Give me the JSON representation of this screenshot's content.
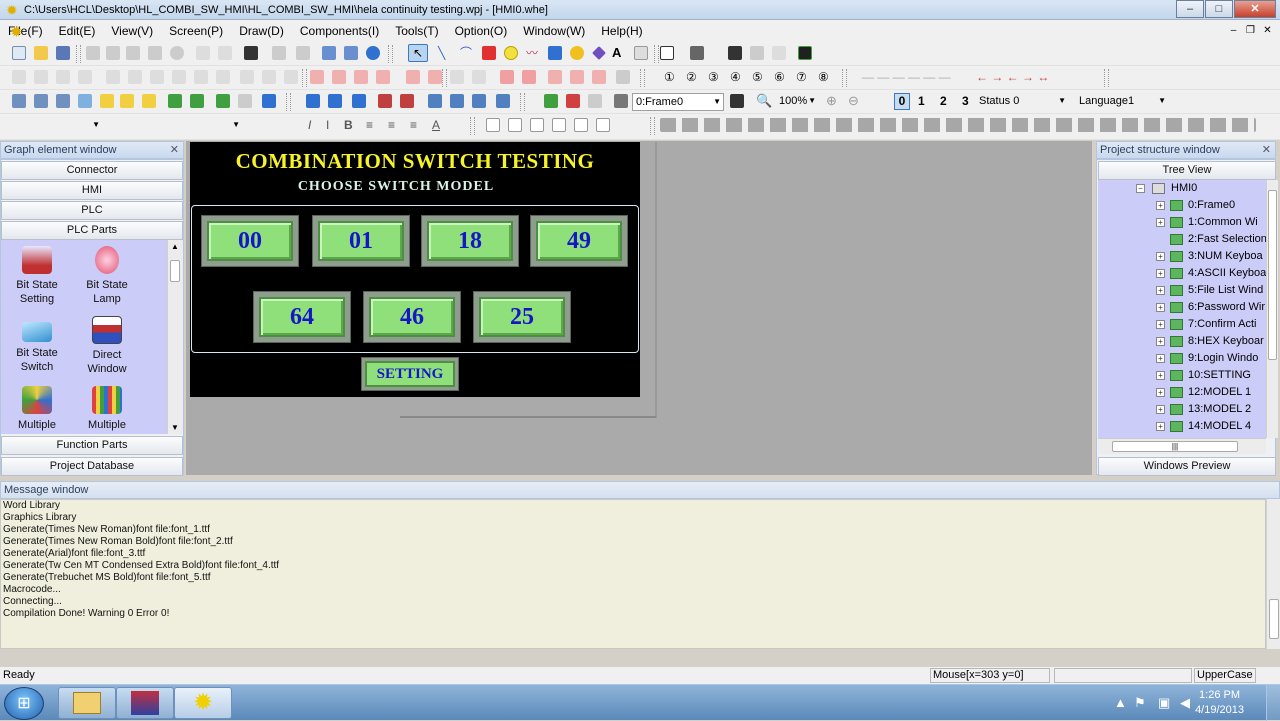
{
  "window": {
    "title": "C:\\Users\\HCL\\Desktop\\HL_COMBI_SW_HMI\\HL_COMBI_SW_HMI\\hela continuity testing.wpj - [HMI0.whe]",
    "minimize": "–",
    "maximize": "□",
    "close": "✕"
  },
  "menu": [
    "File(F)",
    "Edit(E)",
    "View(V)",
    "Screen(P)",
    "Draw(D)",
    "Components(I)",
    "Tools(T)",
    "Option(O)",
    "Window(W)",
    "Help(H)"
  ],
  "toolbar3": {
    "frame_combo": "0:Frame0",
    "zoom_combo": "100%",
    "num0": "0",
    "num1": "1",
    "num2": "2",
    "num3": "3",
    "status_combo": "Status 0",
    "language_combo": "Language1"
  },
  "graph_panel": {
    "title": "Graph element window",
    "categories": {
      "connector": "Connector",
      "hmi": "HMI",
      "plc": "PLC",
      "plc_parts": "PLC Parts",
      "function_parts": "Function Parts",
      "project_database": "Project Database"
    },
    "parts": [
      {
        "label1": "Bit State",
        "label2": "Setting",
        "icon": "bit-state-setting-icon"
      },
      {
        "label1": "Bit State",
        "label2": "Lamp",
        "icon": "bit-state-lamp-icon"
      },
      {
        "label1": "Bit State",
        "label2": "Switch",
        "icon": "bit-state-switch-icon"
      },
      {
        "label1": "Direct",
        "label2": "Window",
        "icon": "direct-window-icon"
      },
      {
        "label1": "Multiple",
        "label2": "",
        "icon": "multiple-state-icon"
      },
      {
        "label1": "Multiple",
        "label2": "",
        "icon": "multiple-bar-icon"
      }
    ]
  },
  "hmi_screen": {
    "title": "COMBINATION SWITCH TESTING",
    "subtitle": "CHOOSE SWITCH MODEL",
    "models": [
      "00",
      "01",
      "18",
      "49",
      "64",
      "46",
      "25"
    ],
    "setting": "SETTING",
    "colors": {
      "background": "#000000",
      "title": "#f7f32a",
      "button_face": "#8fe07a",
      "button_text": "#1616c8"
    }
  },
  "project_panel": {
    "title": "Project structure window",
    "tree_view_label": "Tree View",
    "root": "HMI0",
    "items": [
      "0:Frame0",
      "1:Common Wi",
      "2:Fast Selection",
      "3:NUM Keyboa",
      "4:ASCII Keyboa",
      "5:File List Wind",
      "6:Password Wir",
      "7:Confirm Acti",
      "8:HEX Keyboar",
      "9:Login Windo",
      "10:SETTING",
      "12:MODEL 1",
      "13:MODEL 2",
      "14:MODEL 4"
    ],
    "windows_preview": "Windows Preview"
  },
  "message_window": {
    "title": "Message window",
    "lines": [
      "Word Library",
      "Graphics Library",
      "Generate(Times New Roman)font file:font_1.ttf",
      "Generate(Times New Roman Bold)font file:font_2.ttf",
      "Generate(Arial)font file:font_3.ttf",
      "Generate(Tw Cen MT Condensed Extra Bold)font file:font_4.ttf",
      "Generate(Trebuchet MS Bold)font file:font_5.ttf",
      "Macrocode...",
      "Connecting...",
      "Compilation Done! Warning 0 Error 0!"
    ]
  },
  "statusbar": {
    "ready": "Ready",
    "mouse": "Mouse[x=303  y=0]",
    "case": "UpperCase"
  },
  "taskbar": {
    "time": "1:26 PM",
    "date": "4/19/2013"
  }
}
